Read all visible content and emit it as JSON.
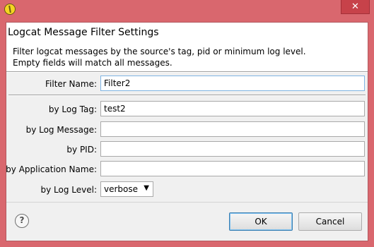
{
  "window": {
    "close_glyph": "✕"
  },
  "header": {
    "title": "Logcat Message Filter Settings",
    "description_line1": "Filter logcat messages by the source's tag, pid or minimum log level.",
    "description_line2": "Empty fields will match all messages."
  },
  "form": {
    "filter_name_label": "Filter Name:",
    "filter_name_value": "Filter2",
    "log_tag_label": "by Log Tag:",
    "log_tag_value": "test2",
    "log_message_label": "by Log Message:",
    "log_message_value": "",
    "pid_label": "by PID:",
    "pid_value": "",
    "app_name_label": "by Application Name:",
    "app_name_value": "",
    "log_level_label": "by Log Level:",
    "log_level_value": "verbose"
  },
  "footer": {
    "help_glyph": "?",
    "ok_label": "OK",
    "cancel_label": "Cancel"
  },
  "icons": [
    "app-icon",
    "close-icon",
    "help-icon",
    "chevron-down-icon"
  ]
}
